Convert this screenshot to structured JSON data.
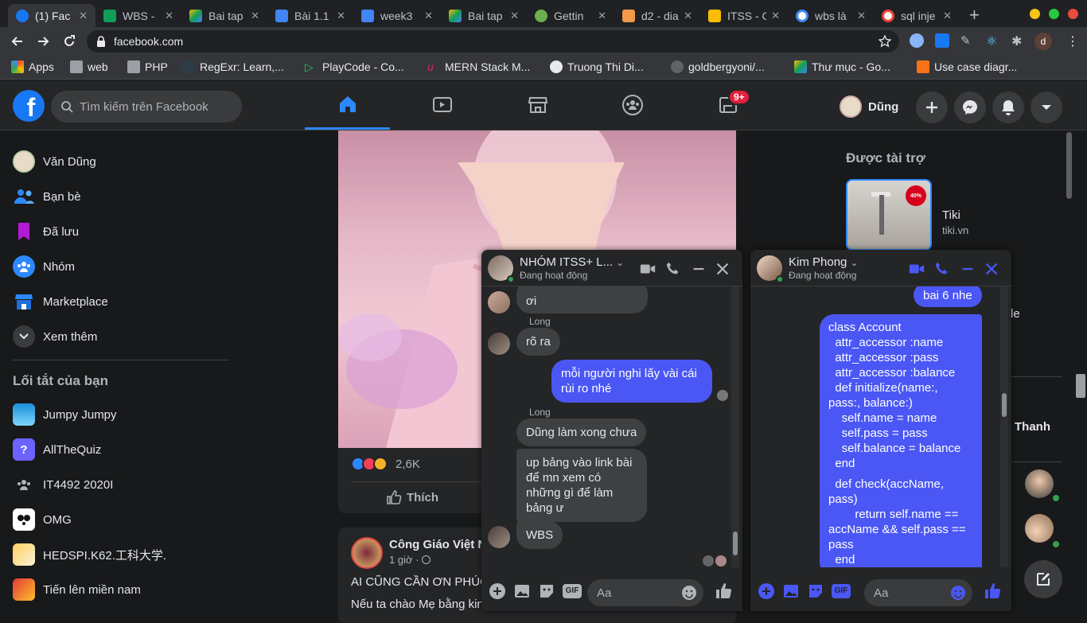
{
  "browser": {
    "tabs": [
      {
        "label": "(1) Fac",
        "color": "#1877f2"
      },
      {
        "label": "WBS - ",
        "color": "#0f9d58"
      },
      {
        "label": "Bai tap",
        "color": "#fbbc04"
      },
      {
        "label": "Bài 1.1",
        "color": "#4285f4"
      },
      {
        "label": "week3",
        "color": "#4285f4"
      },
      {
        "label": "Bai tap",
        "color": "#fbbc04"
      },
      {
        "label": "Gettin",
        "color": "#6ab04c"
      },
      {
        "label": "d2 - dia",
        "color": "#f2994a"
      },
      {
        "label": "ITSS - C",
        "color": "#fbbc04"
      },
      {
        "label": "wbs là",
        "color": "#ffffff"
      },
      {
        "label": "sql inje",
        "color": "#ffffff"
      }
    ],
    "url": "facebook.com",
    "bookmarks": [
      {
        "label": "Apps",
        "color": "#ea4335"
      },
      {
        "label": "web",
        "color": "#9aa0a6"
      },
      {
        "label": "PHP",
        "color": "#9aa0a6"
      },
      {
        "label": "RegExr: Learn,...",
        "color": "#2d3b45"
      },
      {
        "label": "PlayCode - Co...",
        "color": "#22c55e"
      },
      {
        "label": "MERN Stack M...",
        "color": "#e0245e"
      },
      {
        "label": "Truong Thi Di...",
        "color": "#e8eaed"
      },
      {
        "label": "goldbergyoni/...",
        "color": "#e8eaed"
      },
      {
        "label": "Thư mục - Go...",
        "color": "#fbbc04"
      },
      {
        "label": "Use case diagr...",
        "color": "#f97316"
      }
    ]
  },
  "header": {
    "search_placeholder": "Tìm kiếm trên Facebook",
    "badge": "9+",
    "profile_name": "Dũng"
  },
  "sidebar": {
    "items": [
      {
        "label": "Văn Dũng"
      },
      {
        "label": "Bạn bè"
      },
      {
        "label": "Đã lưu"
      },
      {
        "label": "Nhóm"
      },
      {
        "label": "Marketplace"
      },
      {
        "label": "Xem thêm"
      }
    ],
    "shortcuts_title": "Lối tắt của bạn",
    "shortcuts": [
      {
        "label": "Jumpy Jumpy"
      },
      {
        "label": "AllTheQuiz"
      },
      {
        "label": "IT4492 2020I"
      },
      {
        "label": "OMG"
      },
      {
        "label": "HEDSPI.K62.工科大学."
      },
      {
        "label": "Tiến lên miền nam"
      }
    ]
  },
  "feed": {
    "reactions_count": "2,6K",
    "like_label": "Thích",
    "post2": {
      "author": "Công Giáo Việt N",
      "time": "1 giờ ·",
      "line1": "AI CŨNG CẦN ƠN PHÚC",
      "line2": "Nếu ta chào Mẹ bằng kin"
    }
  },
  "right": {
    "sponsored_title": "Được tài trợ",
    "ad_name": "Tiki",
    "ad_domain": "tiki.vn",
    "ad_badge": "40%",
    "partial_text_1": "le",
    "partial_text_2": "Thanh"
  },
  "chat1": {
    "name": "NHÓM ITSS+ L...",
    "status": "Đang hoạt động",
    "messages": {
      "m1": "ơi",
      "s1": "Long",
      "m2": "rõ ra",
      "m3": "mỗi người nghi lấy vài cái rùi ro nhé",
      "s2": "Long",
      "m4": "Dũng làm xong chưa",
      "m5": "up bảng vào link bài để mn xem có những gì để làm bảng ư",
      "m6": "WBS"
    },
    "input_placeholder": "Aa"
  },
  "chat2": {
    "name": "Kim Phong",
    "status": "Đang hoạt động",
    "messages": {
      "m1": "bai 6 nhe",
      "code1": "class Account\n  attr_accessor :name\n  attr_accessor :pass\n  attr_accessor :balance\n  def initialize(name:,\npass:, balance:)\n    self.name = name\n    self.pass = pass\n    self.balance = balance\n  end",
      "code2": "  def check(accName,\npass)\n        return self.name ==\naccName && self.pass ==\npass\n  end"
    },
    "input_placeholder": "Aa"
  }
}
